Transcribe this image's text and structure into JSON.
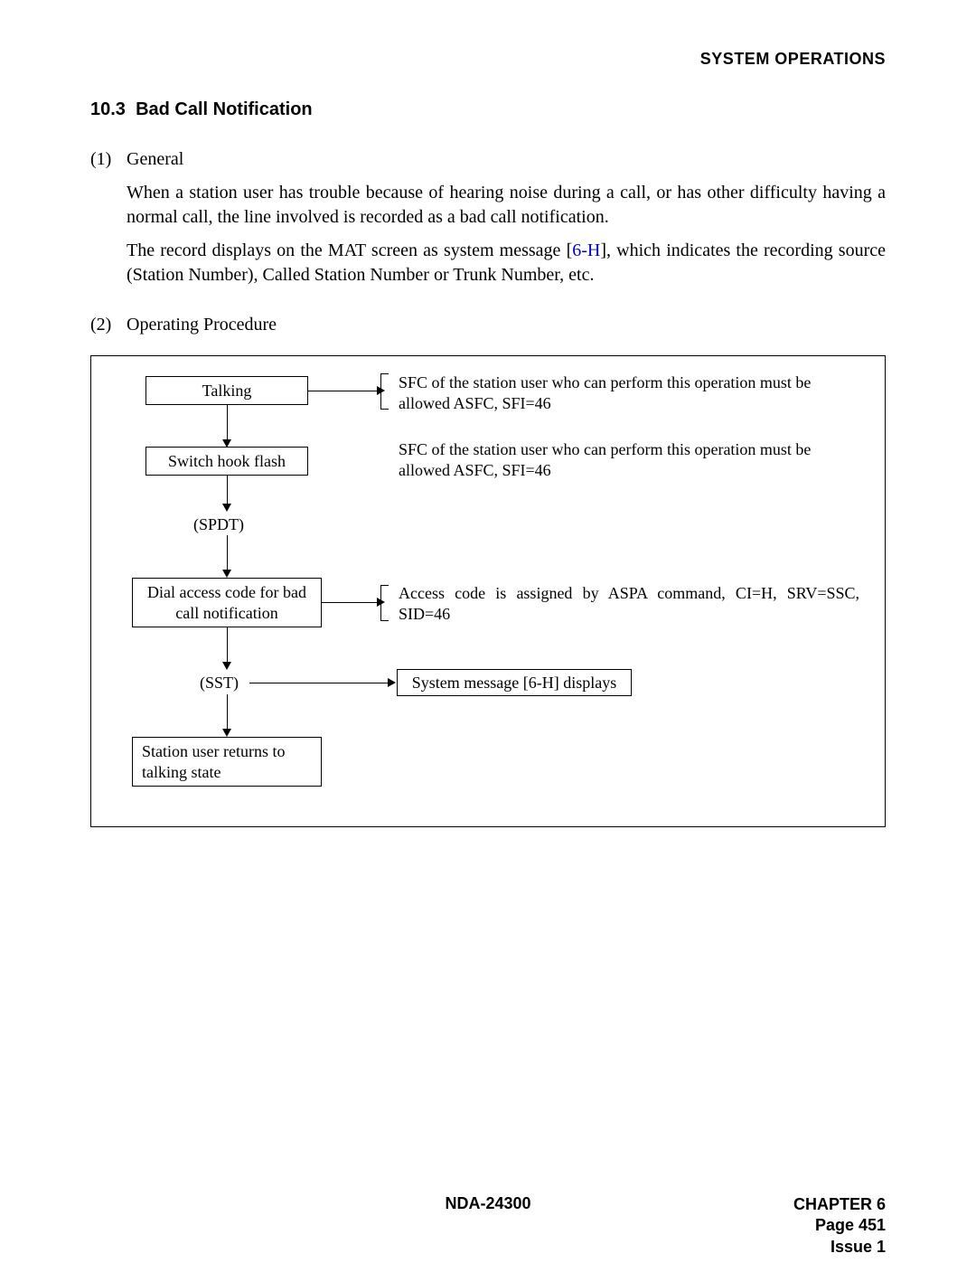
{
  "header": {
    "running": "SYSTEM OPERATIONS"
  },
  "section": {
    "num": "10.3",
    "title": "Bad Call Notification"
  },
  "items": {
    "i1": {
      "num": "(1)",
      "label": "General"
    },
    "i2": {
      "num": "(2)",
      "label": "Operating Procedure"
    }
  },
  "paras": {
    "p1": "When a station user has trouble because of hearing noise during a call, or has other difficulty having a normal call, the line involved is recorded as a bad call notification.",
    "p2a": "The record displays on the MAT screen as system message [",
    "p2link": "6-H",
    "p2b": "], which indicates the recording source (Station Number), Called Station Number or Trunk Number, etc."
  },
  "diagram": {
    "box_talking": "Talking",
    "box_hookflash": "Switch hook flash",
    "lbl_spdt": "(SPDT)",
    "box_dial": "Dial access code for bad call notification",
    "lbl_sst": "(SST)",
    "box_sysmsg": "System message [6-H] displays",
    "box_return": "Station user returns to talking state",
    "note_sfc1": "SFC of the station user who can perform this operation must be allowed ASFC, SFI=46",
    "note_sfc2": "SFC of the station user who can perform this operation must be allowed ASFC, SFI=46",
    "note_access": "Access code is assigned by ASPA command, CI=H, SRV=SSC, SID=46"
  },
  "footer": {
    "doc": "NDA-24300",
    "chapter": "CHAPTER 6",
    "page": "Page 451",
    "issue": "Issue 1"
  }
}
